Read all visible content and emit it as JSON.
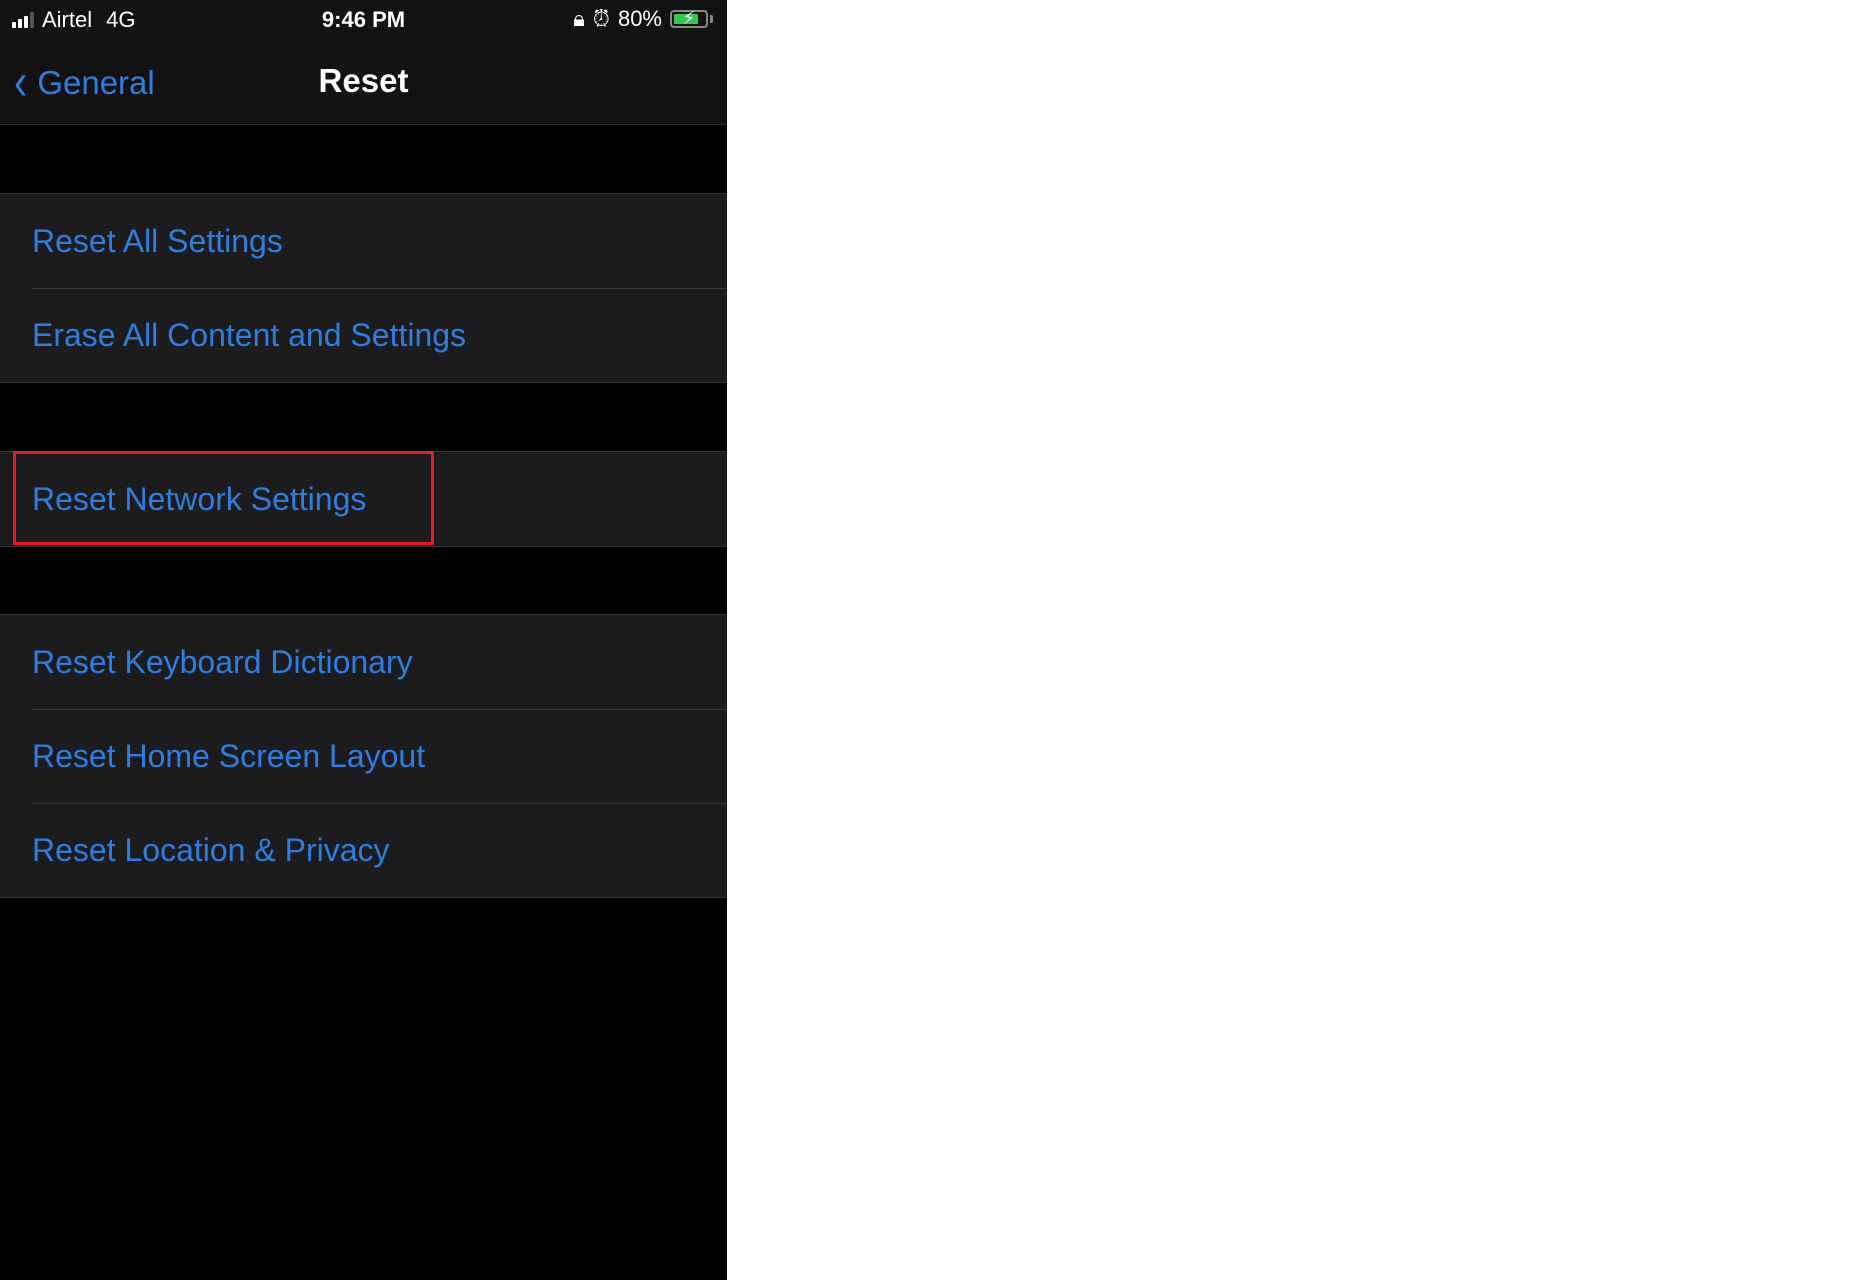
{
  "status_bar": {
    "carrier": "Airtel",
    "network": "4G",
    "time": "9:46 PM",
    "battery_percent_label": "80%",
    "battery_level": 0.8,
    "icons": [
      "signal-icon",
      "rotation-lock-icon",
      "alarm-icon",
      "battery-charging-icon"
    ]
  },
  "nav": {
    "back_label": "General",
    "title": "Reset"
  },
  "groups": [
    {
      "items": [
        {
          "label": "Reset All Settings"
        },
        {
          "label": "Erase All Content and Settings"
        }
      ]
    },
    {
      "items": [
        {
          "label": "Reset Network Settings",
          "highlighted": true
        }
      ]
    },
    {
      "items": [
        {
          "label": "Reset Keyboard Dictionary"
        },
        {
          "label": "Reset Home Screen Layout"
        },
        {
          "label": "Reset Location & Privacy"
        }
      ]
    }
  ],
  "colors": {
    "accent": "#2d7ee0",
    "highlight_box": "#e02020",
    "battery_fill": "#34c759"
  }
}
